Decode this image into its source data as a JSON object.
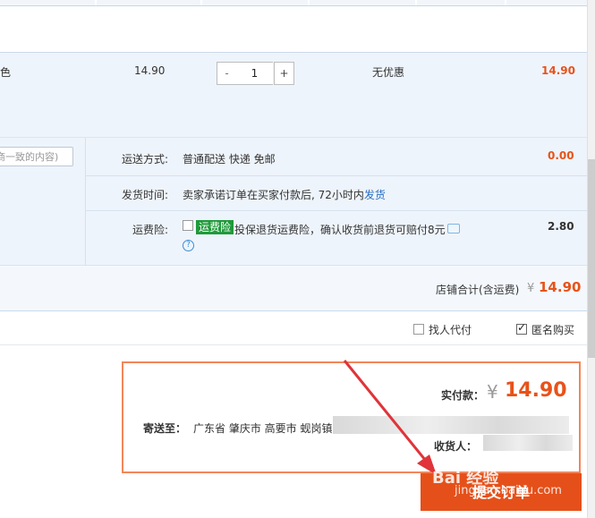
{
  "product": {
    "color_fragment": "色",
    "unit_price": "14.90",
    "quantity": "1",
    "minus": "-",
    "plus": "+",
    "discount": "无优惠",
    "subtotal": "14.90"
  },
  "message": {
    "placeholder": "商一致的内容)"
  },
  "shipping": {
    "label": "运送方式:",
    "value": "普通配送 快递 免邮",
    "cost": "0.00"
  },
  "delivery": {
    "label": "发货时间:",
    "text": "卖家承诺订单在买家付款后, 72小时内",
    "link": "发货"
  },
  "insurance": {
    "label": "运费险:",
    "badge": "运费险",
    "text": "投保退货运费险，确认收货前退货可赔付8元",
    "cost": "2.80",
    "help": "?"
  },
  "shop_total": {
    "label": "店铺合计(含运费)",
    "currency": "¥",
    "value": "14.90"
  },
  "options": {
    "agent_pay": "找人代付",
    "anonymous": "匿名购买"
  },
  "summary": {
    "paid_label": "实付款：",
    "currency": "¥",
    "paid_value": "14.90",
    "ship_to_label": "寄送至：",
    "address": "广东省  肇庆市  高要市  蚬岗镇",
    "receiver_label": "收货人："
  },
  "submit": {
    "label": "提交订单"
  },
  "watermark": {
    "brand": "Bai 经验",
    "url": "jingyan.baidu.com"
  },
  "colors": {
    "accent": "#e8521a",
    "arrow": "#e0343a",
    "badge": "#1f9a3a"
  }
}
